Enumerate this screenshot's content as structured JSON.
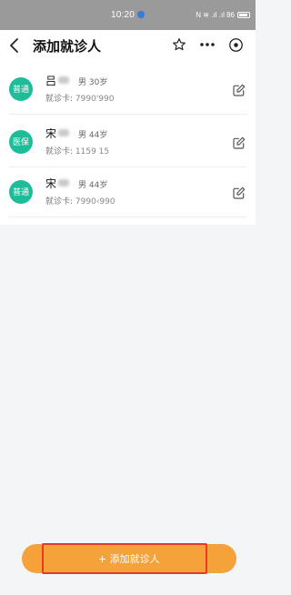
{
  "status_bar": {
    "time": "10:20",
    "right_text": "N ≋ .ıl .ıl 86"
  },
  "nav": {
    "title": "添加就诊人"
  },
  "patients": [
    {
      "type": "普通",
      "name": "吕",
      "meta": "男 30岁",
      "card_label": "就诊卡:",
      "card_value": "7990'990"
    },
    {
      "type": "医保",
      "name": "宋",
      "meta": "男 44岁",
      "card_label": "就诊卡:",
      "card_value": "1159 15"
    },
    {
      "type": "普通",
      "name": "宋",
      "meta": "男 44岁",
      "card_label": "就诊卡:",
      "card_value": "7990‹990"
    }
  ],
  "add_button": {
    "label": "添加就诊人",
    "icon": "plus-icon"
  },
  "colors": {
    "accent": "#f6a23a",
    "badge": "#1dbd9a",
    "highlight": "#e53b1f"
  }
}
